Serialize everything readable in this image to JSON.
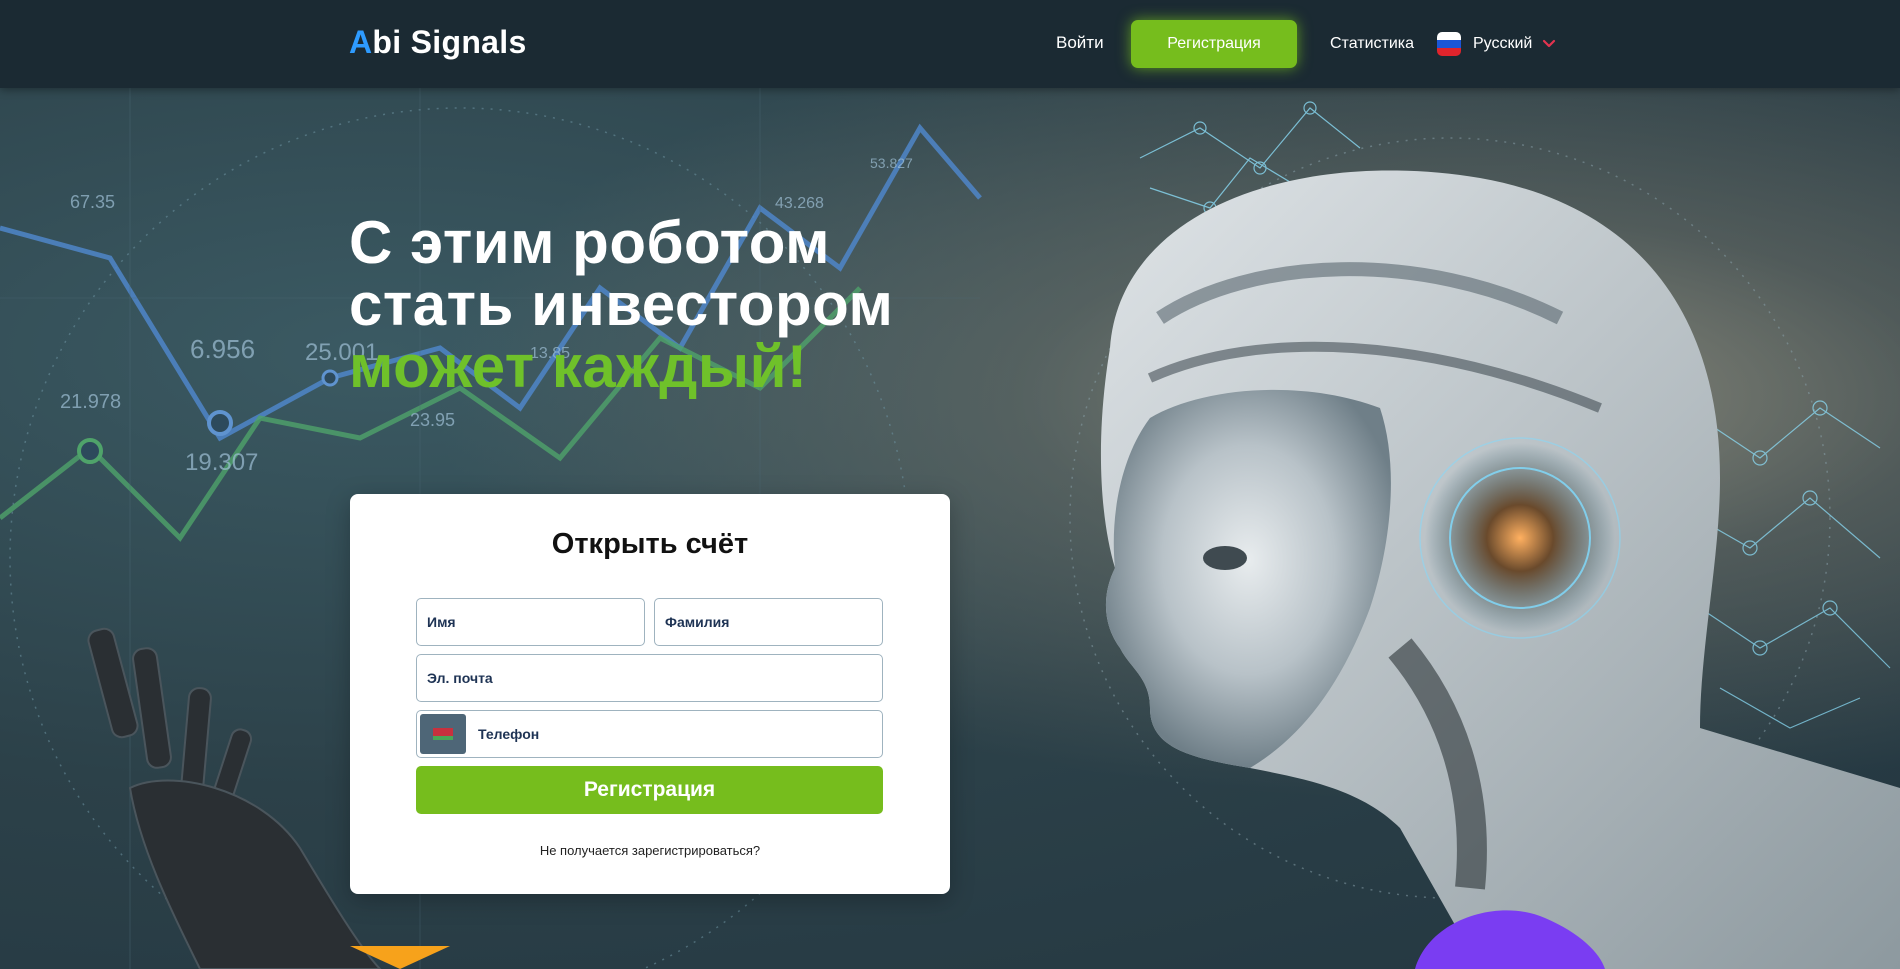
{
  "header": {
    "logo_accent": "A",
    "logo_rest": "bi Signals",
    "nav": {
      "login": "Войти",
      "register": "Регистрация",
      "statistics": "Статистика"
    },
    "language": {
      "label": "Русский",
      "flag_icon": "russia-flag-icon"
    }
  },
  "hero": {
    "headline_line1": "С этим роботом",
    "headline_line2": "стать инвестором",
    "headline_line3": "может каждый!",
    "chart_labels": [
      "6.956",
      "25.001",
      "19.307",
      "21.978",
      "23.95",
      "13.85",
      "43.268",
      "53.827",
      "67.35"
    ]
  },
  "form": {
    "title": "Открыть счёт",
    "first_name_placeholder": "Имя",
    "last_name_placeholder": "Фамилия",
    "email_placeholder": "Эл. почта",
    "phone_placeholder": "Телефон",
    "phone_country_icon": "belarus-flag-icon",
    "submit_label": "Регистрация",
    "help_link": "Не получается зарегистрироваться?"
  },
  "colors": {
    "header_bg": "#1b2a33",
    "accent_green": "#76bd1d",
    "headline_green": "#6fc12a",
    "logo_accent": "#2e9bff"
  }
}
